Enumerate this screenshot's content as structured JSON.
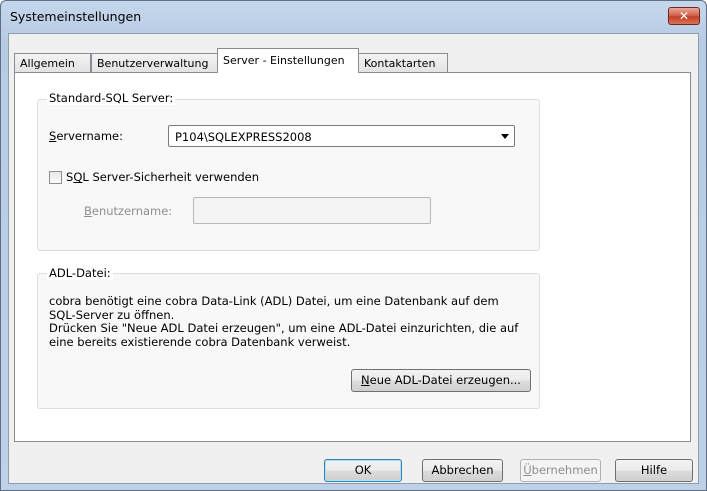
{
  "window": {
    "title": "Systemeinstellungen",
    "close_glyph": "✕"
  },
  "tabs": [
    {
      "label": "Allgemein"
    },
    {
      "label": "Benutzerverwaltung"
    },
    {
      "label": "Server - Einstellungen"
    },
    {
      "label": "Kontaktarten"
    }
  ],
  "sql_group": {
    "legend": "Standard-SQL Server:",
    "servername_label_mnemonic": "S",
    "servername_label_rest": "ervername:",
    "servername_value": "P104\\SQLEXPRESS2008",
    "checkbox_label_pre": "S",
    "checkbox_label_mnemonic": "Q",
    "checkbox_label_rest": "L Server-Sicherheit verwenden",
    "checkbox_checked": false,
    "username_label_mnemonic": "B",
    "username_label_rest": "enutzername:",
    "username_value": ""
  },
  "adl_group": {
    "legend": "ADL-Datei:",
    "info_lines": [
      "cobra benötigt eine cobra Data-Link (ADL) Datei, um eine Datenbank auf dem",
      "SQL-Server zu öffnen.",
      "Drücken Sie \"Neue ADL Datei erzeugen\", um eine ADL-Datei einzurichten, die auf",
      "eine bereits existierende cobra Datenbank verweist."
    ],
    "create_button_mnemonic": "N",
    "create_button_rest": "eue ADL-Datei erzeugen..."
  },
  "footer": {
    "ok_label": "OK",
    "cancel_label": "Abbrechen",
    "apply_mnemonic": "Ü",
    "apply_rest": "bernehmen",
    "help_label": "Hilfe"
  },
  "icons": {
    "close": "close-icon",
    "dropdown": "chevron-down-icon"
  }
}
